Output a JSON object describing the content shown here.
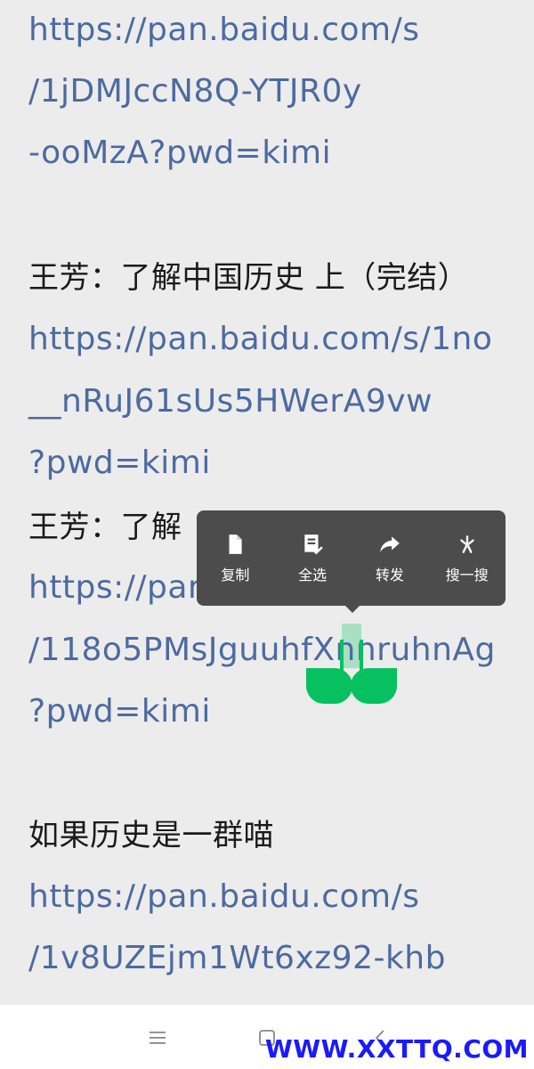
{
  "message": {
    "lines": [
      {
        "kind": "link",
        "text": "https://pan.baidu.com/s"
      },
      {
        "kind": "link",
        "text": "/1jDMJccN8Q-YTJR0y"
      },
      {
        "kind": "link",
        "text": "-ooMzA?pwd=kimi"
      },
      {
        "kind": "title",
        "text": "王芳：了解中国历史 上（完结）"
      },
      {
        "kind": "link",
        "text": "https://pan.baidu.com/s/1no"
      },
      {
        "kind": "link",
        "text": "__nRuJ61sUs5HWerA9vw"
      },
      {
        "kind": "link",
        "text": "?pwd=kimi"
      },
      {
        "kind": "title",
        "text": "王芳：了解"
      },
      {
        "kind": "link",
        "text": "https://par"
      },
      {
        "kind": "link",
        "text": "/118o5PMsJguuhfXnnruhnAg"
      },
      {
        "kind": "link",
        "text": "?pwd=kimi"
      },
      {
        "kind": "title",
        "text": "如果历史是一群喵"
      },
      {
        "kind": "link",
        "text": "https://pan.baidu.com/s"
      },
      {
        "kind": "link",
        "text": "/1v8UZEjm1Wt6xz92-khb"
      }
    ]
  },
  "popup": {
    "copy": "复制",
    "select_all": "全选",
    "forward": "转发",
    "search": "搜一搜"
  },
  "colors": {
    "link": "#4d6aa0",
    "text": "#1a1a1a",
    "background": "#ececec",
    "popup": "#4c4c4c",
    "selection_handle": "#07c160",
    "watermark": "#1a1aff"
  },
  "watermark": "WWW.XXTTQ.COM"
}
